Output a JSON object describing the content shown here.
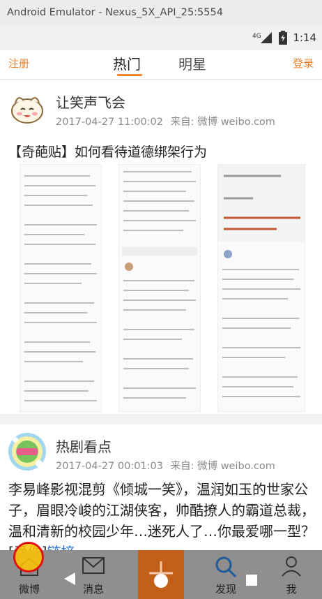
{
  "window": {
    "title": "Android Emulator - Nexus_5X_API_25:5554"
  },
  "status_bar": {
    "network": "4G",
    "time": "1:14"
  },
  "top_nav": {
    "register": "注册",
    "tab_hot": "热门",
    "tab_star": "明星",
    "login": "登录"
  },
  "posts": [
    {
      "author": "让笑声飞会",
      "time": "2017-04-27 11:00:02",
      "source": "来自: 微博 weibo.com",
      "text": "【奇葩贴】如何看待道德绑架行为"
    },
    {
      "author": "热剧看点",
      "time": "2017-04-27 00:01:03",
      "source": "来自: 微博 weibo.com",
      "text": "李易峰影视混剪《倾城一笑》，温润如玉的世家公子，眉眼冷峻的江湖侠客，帅酷撩人的霸道总裁，温和清新的校园少年…迷死人了…你最爱哪一型？[爱你]",
      "link": "链接"
    }
  ],
  "bottom_bar": {
    "weibo": "微博",
    "messages": "消息",
    "discover": "发现",
    "me": "我"
  },
  "colors": {
    "accent": "#f0822a",
    "link": "#1d6bd6",
    "bar": "#8f8f8f",
    "compose": "#c45f1a"
  },
  "icons": [
    "signal-icon",
    "battery-icon",
    "home-icon",
    "mail-icon",
    "plus-icon",
    "search-icon",
    "user-icon",
    "back-icon",
    "circle-home-icon",
    "recent-apps-icon"
  ]
}
